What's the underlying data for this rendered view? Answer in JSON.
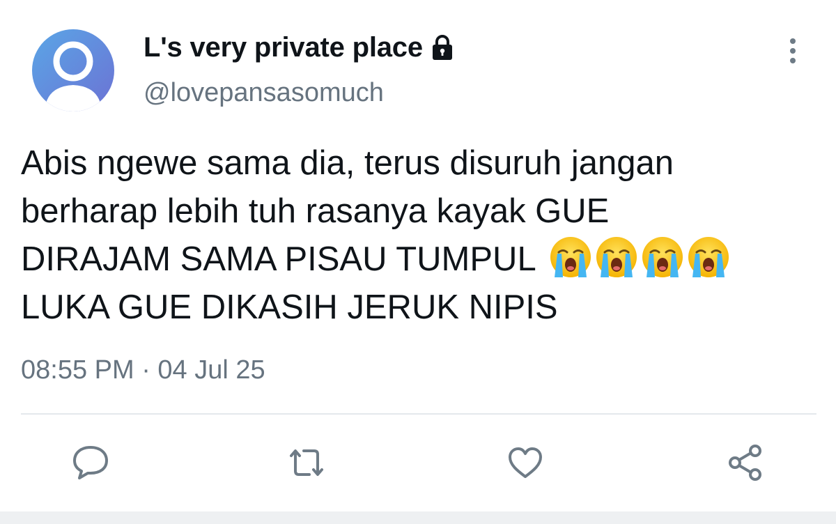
{
  "profile": {
    "display_name": "L's very private place",
    "handle": "@lovepansasomuch",
    "lock_icon": "lock-icon",
    "avatar_gradient": [
      "#5c9fe4",
      "#6a78d6"
    ]
  },
  "tweet": {
    "lines": [
      "Abis ngewe sama dia, terus disuruh jangan",
      "berharap lebih tuh rasanya kayak GUE",
      "DIRAJAM SAMA PISAU TUMPUL",
      "LUKA GUE DIKASIH JERUK NIPIS"
    ],
    "emoji_count": 4,
    "emoji_icon": "loudly-crying-face"
  },
  "meta": {
    "timestamp": "08:55 PM · 04 Jul 25"
  },
  "actions": [
    {
      "name": "reply",
      "icon": "speech-bubble-icon"
    },
    {
      "name": "retweet",
      "icon": "retweet-icon"
    },
    {
      "name": "like",
      "icon": "heart-icon"
    },
    {
      "name": "share",
      "icon": "share-icon"
    }
  ],
  "colors": {
    "text_primary": "#0f1419",
    "text_secondary": "#66737f",
    "icon_gray": "#6e7b86",
    "divider": "#e4e8ec"
  }
}
